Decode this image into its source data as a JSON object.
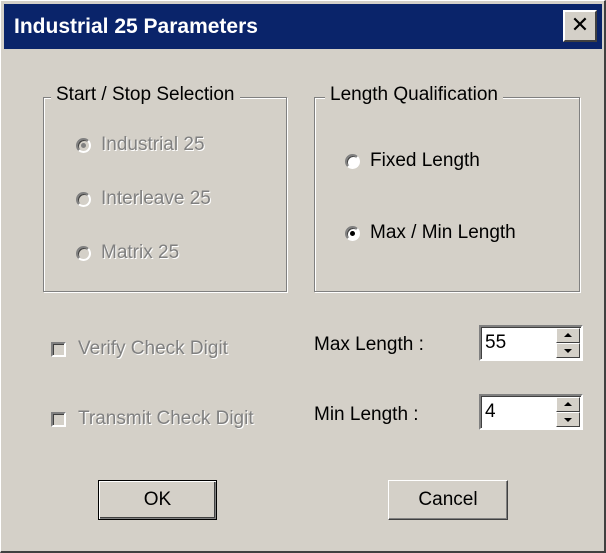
{
  "window": {
    "title": "Industrial 25 Parameters",
    "close_label": "✕"
  },
  "start_stop": {
    "title": "Start / Stop Selection",
    "options": [
      {
        "label": "Industrial 25",
        "checked": true
      },
      {
        "label": "Interleave 25",
        "checked": false
      },
      {
        "label": "Matrix 25",
        "checked": false
      }
    ]
  },
  "length_qualification": {
    "title": "Length Qualification",
    "options": [
      {
        "label": "Fixed Length",
        "checked": false
      },
      {
        "label": "Max / Min Length",
        "checked": true
      }
    ]
  },
  "checks": {
    "verify": {
      "label": "Verify Check Digit",
      "checked": false
    },
    "transmit": {
      "label": "Transmit Check Digit",
      "checked": false
    }
  },
  "max_length": {
    "label": "Max Length :",
    "value": "55"
  },
  "min_length": {
    "label": "Min Length :",
    "value": "4"
  },
  "buttons": {
    "ok": "OK",
    "cancel": "Cancel"
  }
}
